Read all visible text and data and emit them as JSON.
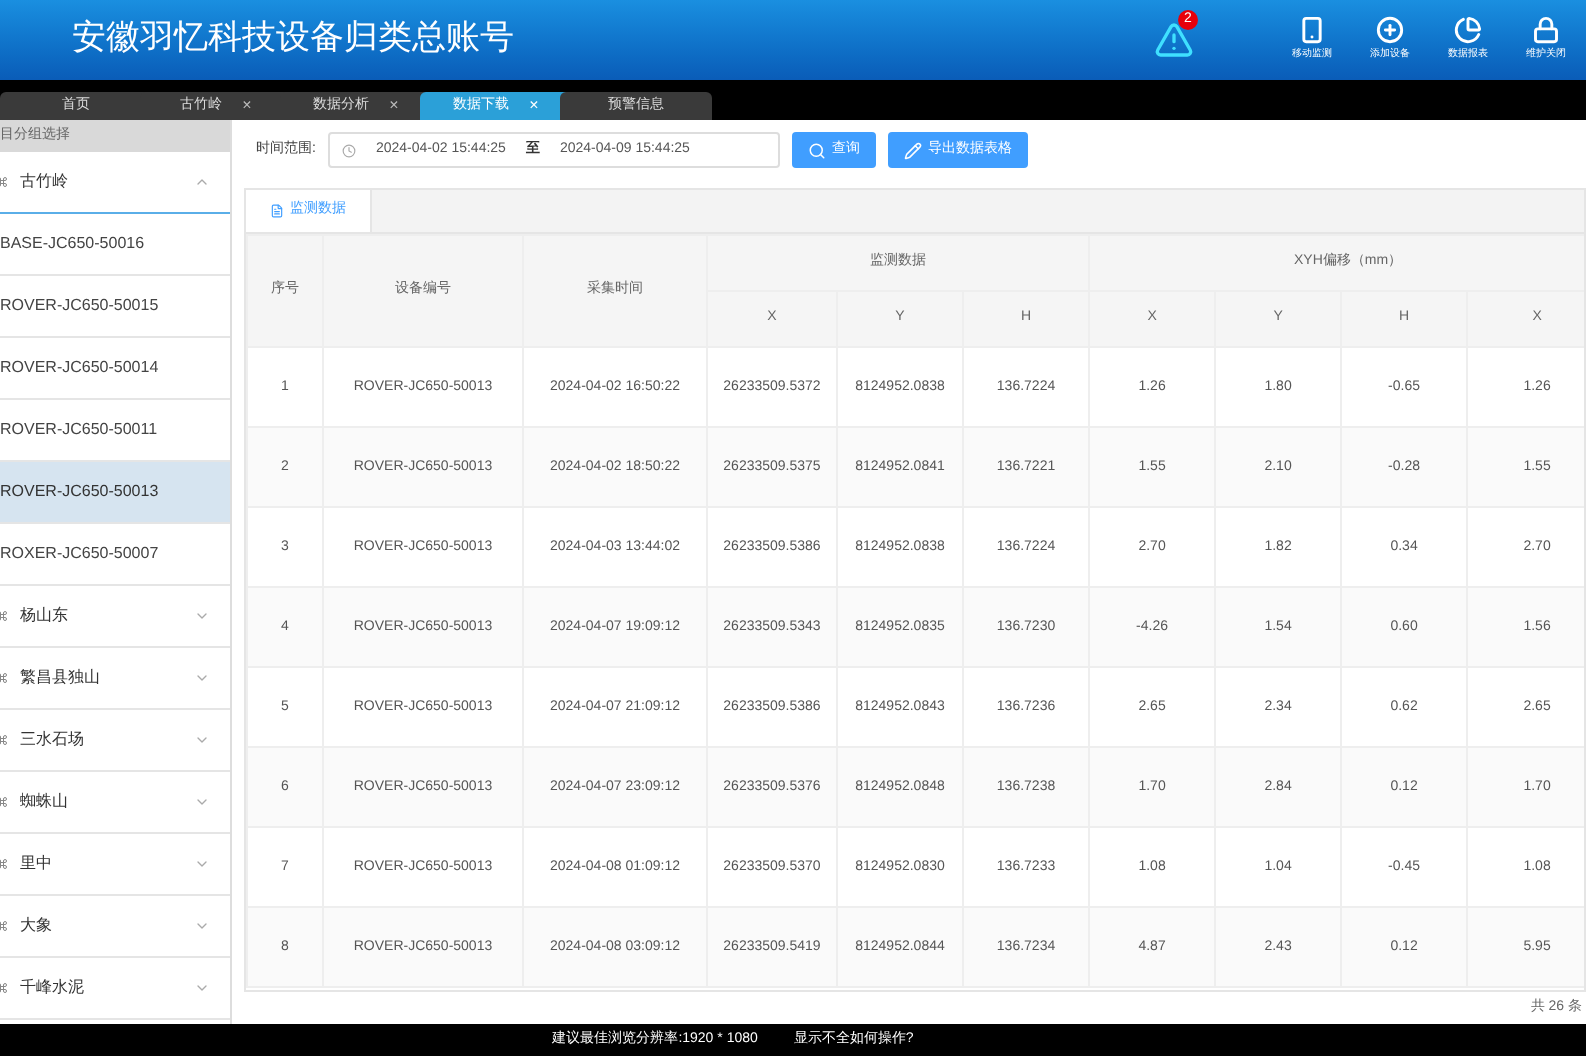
{
  "header": {
    "title": "安徽羽忆科技设备归类总账号",
    "alert_count": "2",
    "actions": [
      {
        "kind": "phone",
        "label": "移动监测"
      },
      {
        "kind": "add",
        "label": "添加设备"
      },
      {
        "kind": "chart",
        "label": "数据报表"
      },
      {
        "kind": "lock",
        "label": "维护关闭"
      }
    ]
  },
  "tabs": [
    {
      "label": "首页",
      "selected": false
    },
    {
      "label": "古竹岭",
      "close": "×",
      "selected": false
    },
    {
      "label": "数据分析",
      "close": "×",
      "selected": false
    },
    {
      "label": "数据下载",
      "close": "×",
      "selected": true
    },
    {
      "label": "预警信息",
      "selected": false
    }
  ],
  "sidebar": {
    "title": "目分组选择",
    "groups": [
      {
        "label": "古竹岭",
        "expanded": true,
        "children": [
          {
            "label": "BASE-JC650-50016",
            "selected": false
          },
          {
            "label": "ROVER-JC650-50015",
            "selected": false
          },
          {
            "label": "ROVER-JC650-50014",
            "selected": false
          },
          {
            "label": "ROVER-JC650-50011",
            "selected": false
          },
          {
            "label": "ROVER-JC650-50013",
            "selected": true
          },
          {
            "label": "ROXER-JC650-50007",
            "selected": false
          }
        ]
      },
      {
        "label": "杨山东",
        "expanded": false
      },
      {
        "label": "繁昌县独山",
        "expanded": false
      },
      {
        "label": "三水石场",
        "expanded": false
      },
      {
        "label": "蜘蛛山",
        "expanded": false
      },
      {
        "label": "里中",
        "expanded": false
      },
      {
        "label": "大象",
        "expanded": false
      },
      {
        "label": "千峰水泥",
        "expanded": false
      }
    ]
  },
  "filter": {
    "label": "时间范围:",
    "start": "2024-04-02 15:44:25",
    "separator": "至",
    "end": "2024-04-09 15:44:25",
    "buttons": [
      {
        "kind": "search",
        "label": "查询"
      },
      {
        "kind": "export",
        "label": "导出数据表格"
      }
    ]
  },
  "panel_tab": "监测数据",
  "table": {
    "columns": [
      "序号",
      "设备编号",
      "采集时间"
    ],
    "groups": [
      {
        "label": "监测数据",
        "columns": [
          "X",
          "Y",
          "H"
        ]
      },
      {
        "label": "XYH偏移（mm）",
        "columns": [
          "X",
          "Y",
          "H",
          "X"
        ]
      }
    ],
    "rows": [
      [
        "1",
        "ROVER-JC650-50013",
        "2024-04-02 16:50:22",
        "26233509.5372",
        "8124952.0838",
        "136.7224",
        "1.26",
        "1.80",
        "-0.65",
        "1.26"
      ],
      [
        "2",
        "ROVER-JC650-50013",
        "2024-04-02 18:50:22",
        "26233509.5375",
        "8124952.0841",
        "136.7221",
        "1.55",
        "2.10",
        "-0.28",
        "1.55"
      ],
      [
        "3",
        "ROVER-JC650-50013",
        "2024-04-03 13:44:02",
        "26233509.5386",
        "8124952.0838",
        "136.7224",
        "2.70",
        "1.82",
        "0.34",
        "2.70"
      ],
      [
        "4",
        "ROVER-JC650-50013",
        "2024-04-07 19:09:12",
        "26233509.5343",
        "8124952.0835",
        "136.7230",
        "-4.26",
        "1.54",
        "0.60",
        "1.56"
      ],
      [
        "5",
        "ROVER-JC650-50013",
        "2024-04-07 21:09:12",
        "26233509.5386",
        "8124952.0843",
        "136.7236",
        "2.65",
        "2.34",
        "0.62",
        "2.65"
      ],
      [
        "6",
        "ROVER-JC650-50013",
        "2024-04-07 23:09:12",
        "26233509.5376",
        "8124952.0848",
        "136.7238",
        "1.70",
        "2.84",
        "0.12",
        "1.70"
      ],
      [
        "7",
        "ROVER-JC650-50013",
        "2024-04-08 01:09:12",
        "26233509.5370",
        "8124952.0830",
        "136.7233",
        "1.08",
        "1.04",
        "-0.45",
        "1.08"
      ],
      [
        "8",
        "ROVER-JC650-50013",
        "2024-04-08 03:09:12",
        "26233509.5419",
        "8124952.0844",
        "136.7234",
        "4.87",
        "2.43",
        "0.12",
        "5.95"
      ]
    ],
    "total": "共 26 条"
  },
  "footer": {
    "resolution": "建议最佳浏览分辨率:1920 * 1080",
    "help": "显示不全如何操作?"
  }
}
